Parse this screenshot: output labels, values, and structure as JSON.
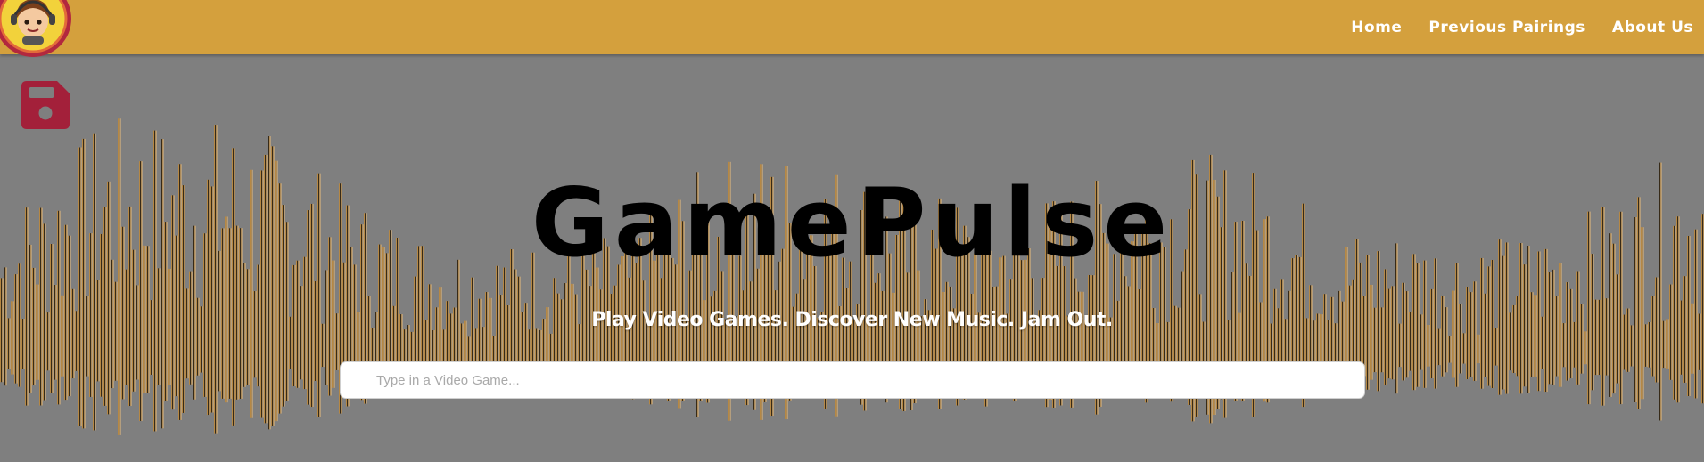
{
  "navbar": {
    "links": [
      {
        "label": "Home"
      },
      {
        "label": "Previous Pairings"
      },
      {
        "label": "About Us"
      }
    ],
    "bar_color": "#d4a03d"
  },
  "logo": {
    "icon": "gamer-mascot-icon",
    "ring_color": "#b2283e"
  },
  "save": {
    "icon": "floppy-disk-icon",
    "color": "#a3203a"
  },
  "hero": {
    "title": "GamePulse",
    "tagline": "Play Video Games. Discover New Music. Jam Out.",
    "background_color": "#7f7f7f",
    "wave_colors": [
      "#e8a94b",
      "#8a6b3d",
      "#000000",
      "#f7c885"
    ]
  },
  "search": {
    "placeholder": "Type in a Video Game..."
  }
}
